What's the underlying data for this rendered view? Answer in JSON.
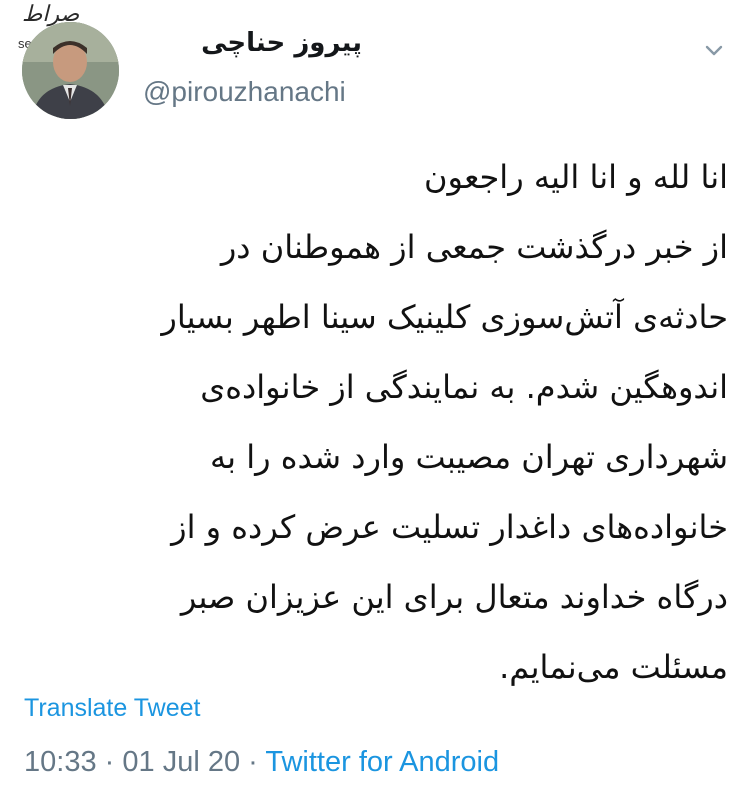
{
  "watermark": {
    "logo_text": "صراط",
    "site": "seratnews.ir"
  },
  "user": {
    "display_name": "پیروز حناچی",
    "handle": "@pirouzhanachi"
  },
  "tweet": {
    "lines": [
      "انا لله و انا الیه راجعون",
      "از خبر درگذشت جمعی از هموطنان در",
      "حادثه‌ی آتش‌سوزی کلینیک سینا اطهر بسیار",
      "اندوهگین شدم. به نمایندگی از خانواده‌ی",
      "شهرداری تهران مصیبت وارد شده را به",
      "خانواده‌های داغدار تسلیت عرض کرده و از",
      "درگاه خداوند متعال برای این عزیزان صبر",
      "مسئلت می‌نمایم."
    ],
    "translate_label": "Translate Tweet",
    "time": "10:33",
    "separator": "·",
    "date": "01 Jul 20",
    "source": "Twitter for Android"
  },
  "icons": {
    "menu": "chevron-down-icon",
    "avatar": "profile-photo"
  },
  "colors": {
    "link": "#1b95e0",
    "secondary": "#657786",
    "text": "#14171a"
  }
}
